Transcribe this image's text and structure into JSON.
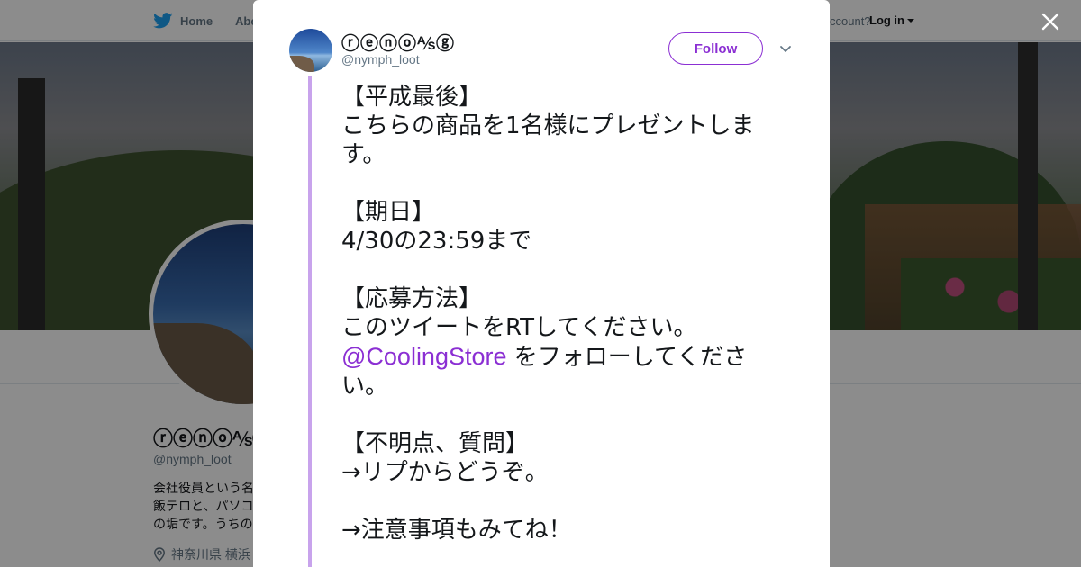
{
  "topbar": {
    "home_label": "Home",
    "about_label": "Abo",
    "account_text": "ccount?",
    "login_label": "Log in"
  },
  "profile": {
    "name": "ⓡⓔⓝⓞ⅍ⓖ",
    "handle": "@nymph_loot",
    "bio_lines": [
      "会社役員という名",
      "飯テロと、パソコ",
      "の垢です。うちの"
    ],
    "location": "神奈川県 横浜"
  },
  "tweet": {
    "display_name": "ⓡⓔⓝⓞ⅍ⓖ",
    "handle": "@nymph_loot",
    "follow_label": "Follow",
    "lines": [
      "【平成最後】",
      "こちらの商品を1名様にプレゼントしま",
      "す。",
      "",
      "【期日】",
      "4/30の23:59まで",
      "",
      "【応募方法】",
      "このツイートをRTしてください。",
      "",
      "い。",
      "",
      "【不明点、質問】",
      "→リプからどうぞ。",
      "",
      "→注意事項もみてね！"
    ],
    "mention": "@CoolingStore",
    "mention_suffix": " をフォローしてくださ"
  },
  "colors": {
    "accent": "#8b2fd3",
    "thread_line": "#c8a3ec",
    "text": "#14171a",
    "muted": "#657786"
  },
  "icons": {
    "brand": "twitter-bird-icon",
    "close": "close-icon",
    "menu": "chevron-down-icon",
    "location": "location-pin-icon"
  }
}
